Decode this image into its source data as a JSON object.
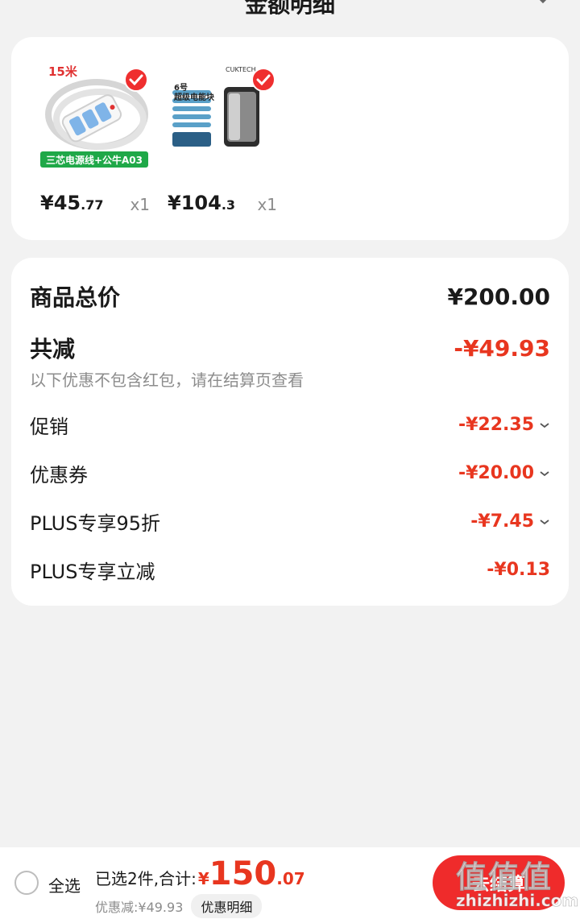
{
  "header": {
    "title": "金额明细"
  },
  "products": [
    {
      "image_label": "15米",
      "image_banner": "三芯电源线+公牛A03",
      "price_symbol": "¥",
      "price_int": "45",
      "price_dec": ".77",
      "qty": "x1"
    },
    {
      "image_brand": "CUKTECH",
      "image_title_1": "6号",
      "image_title_2": "超级电能块",
      "price_symbol": "¥",
      "price_int": "104",
      "price_dec": ".3",
      "qty": "x1"
    }
  ],
  "summary": {
    "total_label": "商品总价",
    "total_value": "¥200.00",
    "reduce_label": "共减",
    "reduce_value": "-¥49.93",
    "note": "以下优惠不包含红包，请在结算页查看",
    "items": [
      {
        "label": "促销",
        "value": "-¥22.35",
        "expandable": true
      },
      {
        "label": "优惠券",
        "value": "-¥20.00",
        "expandable": true
      },
      {
        "label": "PLUS专享95折",
        "value": "-¥7.45",
        "expandable": true
      },
      {
        "label": "PLUS专享立减",
        "value": "-¥0.13",
        "expandable": false
      }
    ]
  },
  "bottom": {
    "select_all": "全选",
    "selected_total_label": "已选2件,合计:",
    "currency": "¥",
    "total_int": "150",
    "total_dec": ".07",
    "discount_text": "优惠减:¥49.93",
    "detail_button": "优惠明细",
    "checkout": "去结算"
  },
  "watermark": {
    "big": "值值值",
    "small": "zhizhizhi.com"
  },
  "colors": {
    "accent": "#e8361f",
    "button": "#ef2b2b",
    "background": "#f2f2f2"
  }
}
